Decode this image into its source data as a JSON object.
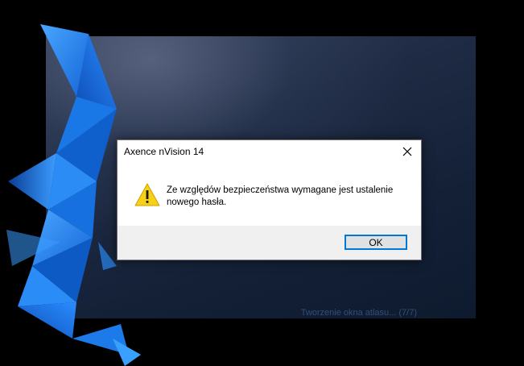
{
  "splash": {
    "status_text": "Tworzenie okna atlasu... (7/7)"
  },
  "dialog": {
    "title": "Axence nVision 14",
    "message": "Ze względów bezpieczeństwa wymagane jest ustalenie nowego hasła.",
    "ok_label": "OK",
    "icon": "warning-icon",
    "close_icon": "close-icon"
  },
  "colors": {
    "accent": "#0078d7",
    "origami_blue": "#1f7fe8",
    "splash_bg": "#1a263d",
    "status_text": "#2f4f7a",
    "warning_yellow": "#f7d117"
  }
}
